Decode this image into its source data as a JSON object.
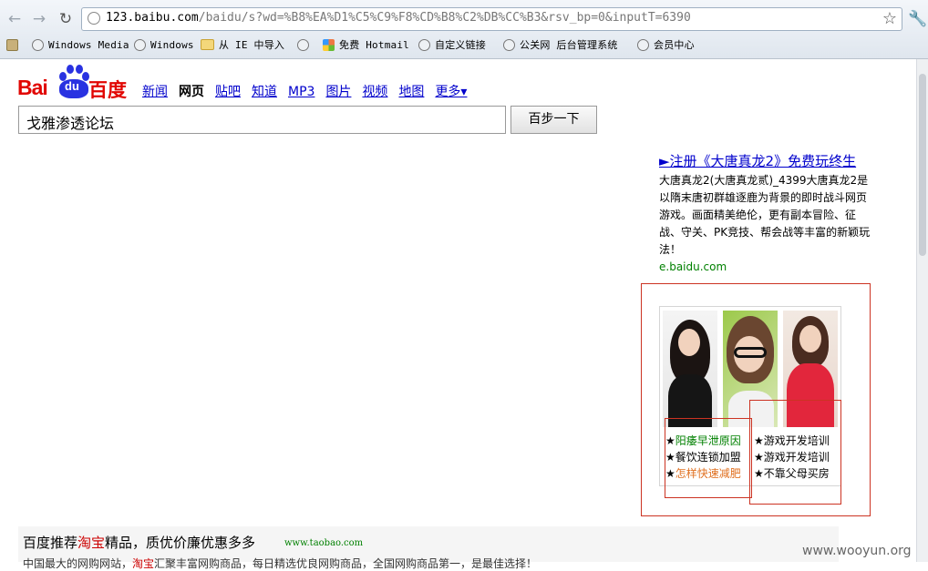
{
  "browser": {
    "url_host": "123.baibu.com",
    "url_path": "/baidu/s?wd=%B8%EA%D1%C5%C9%F8%CD%B8%C2%DB%CC%B3&rsv_bp=0&inputT=6390",
    "bookmarks": [
      "Windows Media",
      "Windows",
      "从 IE 中导入",
      "",
      "免费 Hotmail",
      "自定义链接",
      "公关网 后台管理系统",
      "会员中心"
    ]
  },
  "baidu": {
    "logo_text": "Bai",
    "logo_du": "du",
    "logo_cn": "百度",
    "tabs": [
      "新闻",
      "网页",
      "贴吧",
      "知道",
      "MP3",
      "图片",
      "视频",
      "地图",
      "更多▾"
    ],
    "active_tab": "网页",
    "search_value": "戈雅渗透论坛",
    "search_button": "百步一下"
  },
  "ad": {
    "title": "►注册《大唐真龙2》免费玩终生",
    "body": "大唐真龙2(大唐真龙贰)_4399大唐真龙2是以隋末唐初群雄逐鹿为背景的即时战斗网页游戏。画面精美绝伦，更有副本冒险、征战、守关、PK竞技、帮会战等丰富的新颖玩法！",
    "url": "e.baidu.com"
  },
  "image_ad": {
    "left_links": [
      {
        "star": "★",
        "text": "阳痿早泄原因",
        "color": "#008000"
      },
      {
        "star": "★",
        "text": "餐饮连锁加盟",
        "color": "#000000"
      },
      {
        "star": "★",
        "text": "怎样快速减肥",
        "color": "#e07020"
      }
    ],
    "right_links": [
      {
        "star": "★",
        "text": "游戏开发培训",
        "color": "#000000"
      },
      {
        "star": "★",
        "text": "游戏开发培训",
        "color": "#000000"
      },
      {
        "star": "★",
        "text": "不靠父母买房",
        "color": "#000000"
      }
    ]
  },
  "promo": {
    "title_pre": "百度推荐",
    "title_hl": "淘宝",
    "title_post": "精品，质优价廉优惠多多",
    "url": "www.taobao.com",
    "sub_pre": "中国最大的网购网站，",
    "sub_hl": "淘宝",
    "sub_post": "汇聚丰富网购商品，每日精选优良网购商品，全国网购商品第一，是最佳选择！"
  },
  "watermark": "www.wooyun.org",
  "colors": {
    "baidu_red": "#e10602",
    "baidu_blue": "#2932e1",
    "link_blue": "#0000cc",
    "ad_green": "#008000",
    "highlight_box": "#cc3322"
  }
}
